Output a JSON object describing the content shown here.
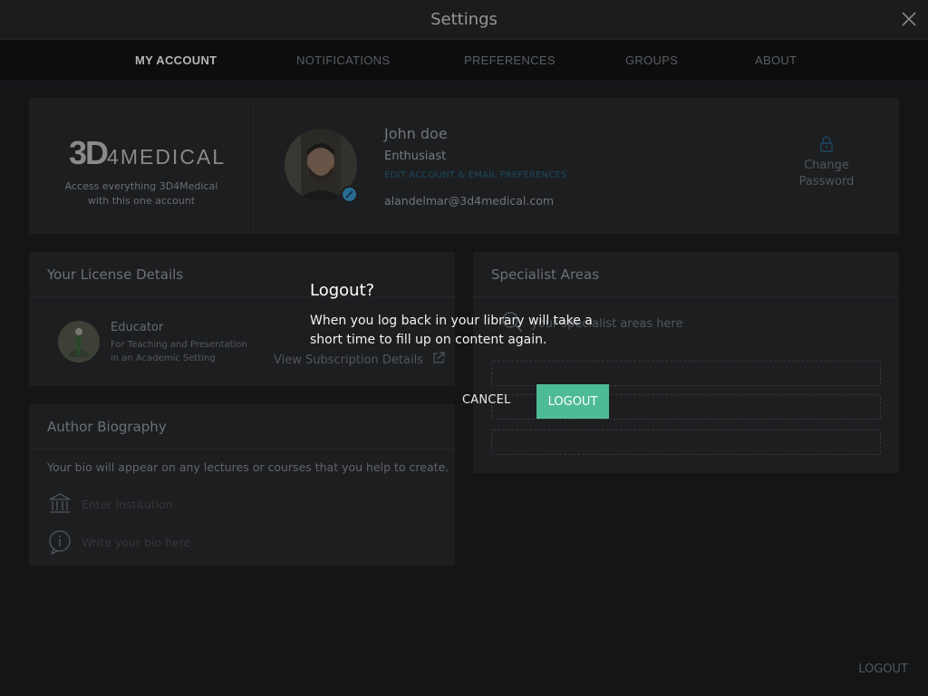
{
  "window": {
    "title": "Settings"
  },
  "tabs": [
    {
      "label": "MY ACCOUNT",
      "active": true
    },
    {
      "label": "NOTIFICATIONS",
      "active": false
    },
    {
      "label": "PREFERENCES",
      "active": false
    },
    {
      "label": "GROUPS",
      "active": false
    },
    {
      "label": "ABOUT",
      "active": false
    }
  ],
  "account": {
    "brand_logo_3d": "3D",
    "brand_logo_rest": "4MEDICAL",
    "brand_subtitle_1": "Access everything 3D4Medical",
    "brand_subtitle_2": "with this one account",
    "name": "John doe",
    "role": "Enthusiast",
    "edit_link": "EDIT ACCOUNT & EMAIL PREFERENCES",
    "email": "alandelmar@3d4medical.com",
    "change_password_1": "Change",
    "change_password_2": "Password"
  },
  "license": {
    "heading": "Your License Details",
    "title": "Educator",
    "subtitle_1": "For Teaching and Presentation",
    "subtitle_2": "in an Academic Setting",
    "link": "View Subscription Details"
  },
  "specialist": {
    "heading": "Specialist Areas",
    "placeholder": "your specialist areas here"
  },
  "bio": {
    "heading": "Author Biography",
    "text": "Your bio will appear on any lectures or courses that you help to create.",
    "institution_placeholder": "Enter institution",
    "bio_placeholder": "Write your bio here"
  },
  "footer": {
    "logout_label": "LOGOUT"
  },
  "dialog": {
    "title": "Logout?",
    "message": "When you log back in your library will take a short time to fill up on content again.",
    "cancel_label": "CANCEL",
    "logout_label": "LOGOUT"
  },
  "colors": {
    "accent_green": "#4ebb97",
    "link_blue": "#1f4a62"
  }
}
